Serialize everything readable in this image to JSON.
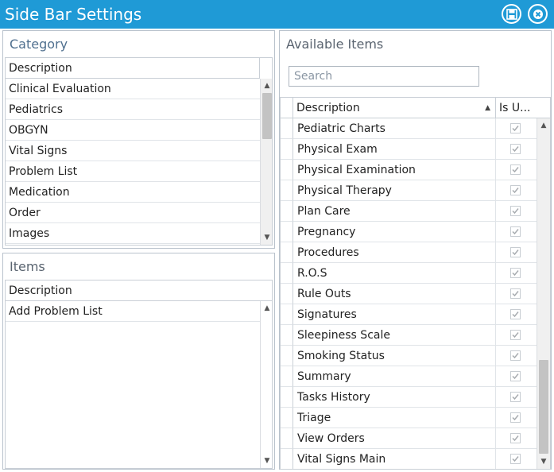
{
  "window": {
    "title": "Side Bar Settings",
    "save_icon": "save-icon",
    "close_icon": "close-icon"
  },
  "colors": {
    "titlebar": "#1f9ad6",
    "panel_header": "#50708f",
    "border": "#b9c2cc"
  },
  "category": {
    "header": "Category",
    "column": "Description",
    "rows": [
      "Clinical Evaluation",
      "Pediatrics",
      "OBGYN",
      "Vital Signs",
      "Problem List",
      "Medication",
      "Order",
      "Images"
    ]
  },
  "items": {
    "header": "Items",
    "column": "Description",
    "rows": [
      "Add Problem List"
    ]
  },
  "available": {
    "header": "Available Items",
    "search_placeholder": "Search",
    "columns": {
      "description": "Description",
      "is_used": "Is U..."
    },
    "sort_icon": "sort-up-icon",
    "rows": [
      {
        "label": "Pediatric Charts",
        "checked": true
      },
      {
        "label": "Physical Exam",
        "checked": true
      },
      {
        "label": "Physical Examination",
        "checked": true
      },
      {
        "label": "Physical Therapy",
        "checked": true
      },
      {
        "label": "Plan Care",
        "checked": true
      },
      {
        "label": "Pregnancy",
        "checked": true
      },
      {
        "label": "Procedures",
        "checked": true
      },
      {
        "label": "R.O.S",
        "checked": true
      },
      {
        "label": "Rule Outs",
        "checked": true
      },
      {
        "label": "Signatures",
        "checked": true
      },
      {
        "label": "Sleepiness Scale",
        "checked": true
      },
      {
        "label": "Smoking Status",
        "checked": true
      },
      {
        "label": "Summary",
        "checked": true
      },
      {
        "label": "Tasks History",
        "checked": true
      },
      {
        "label": "Triage",
        "checked": true
      },
      {
        "label": "View Orders",
        "checked": true
      },
      {
        "label": "Vital Signs Main",
        "checked": true
      }
    ]
  }
}
